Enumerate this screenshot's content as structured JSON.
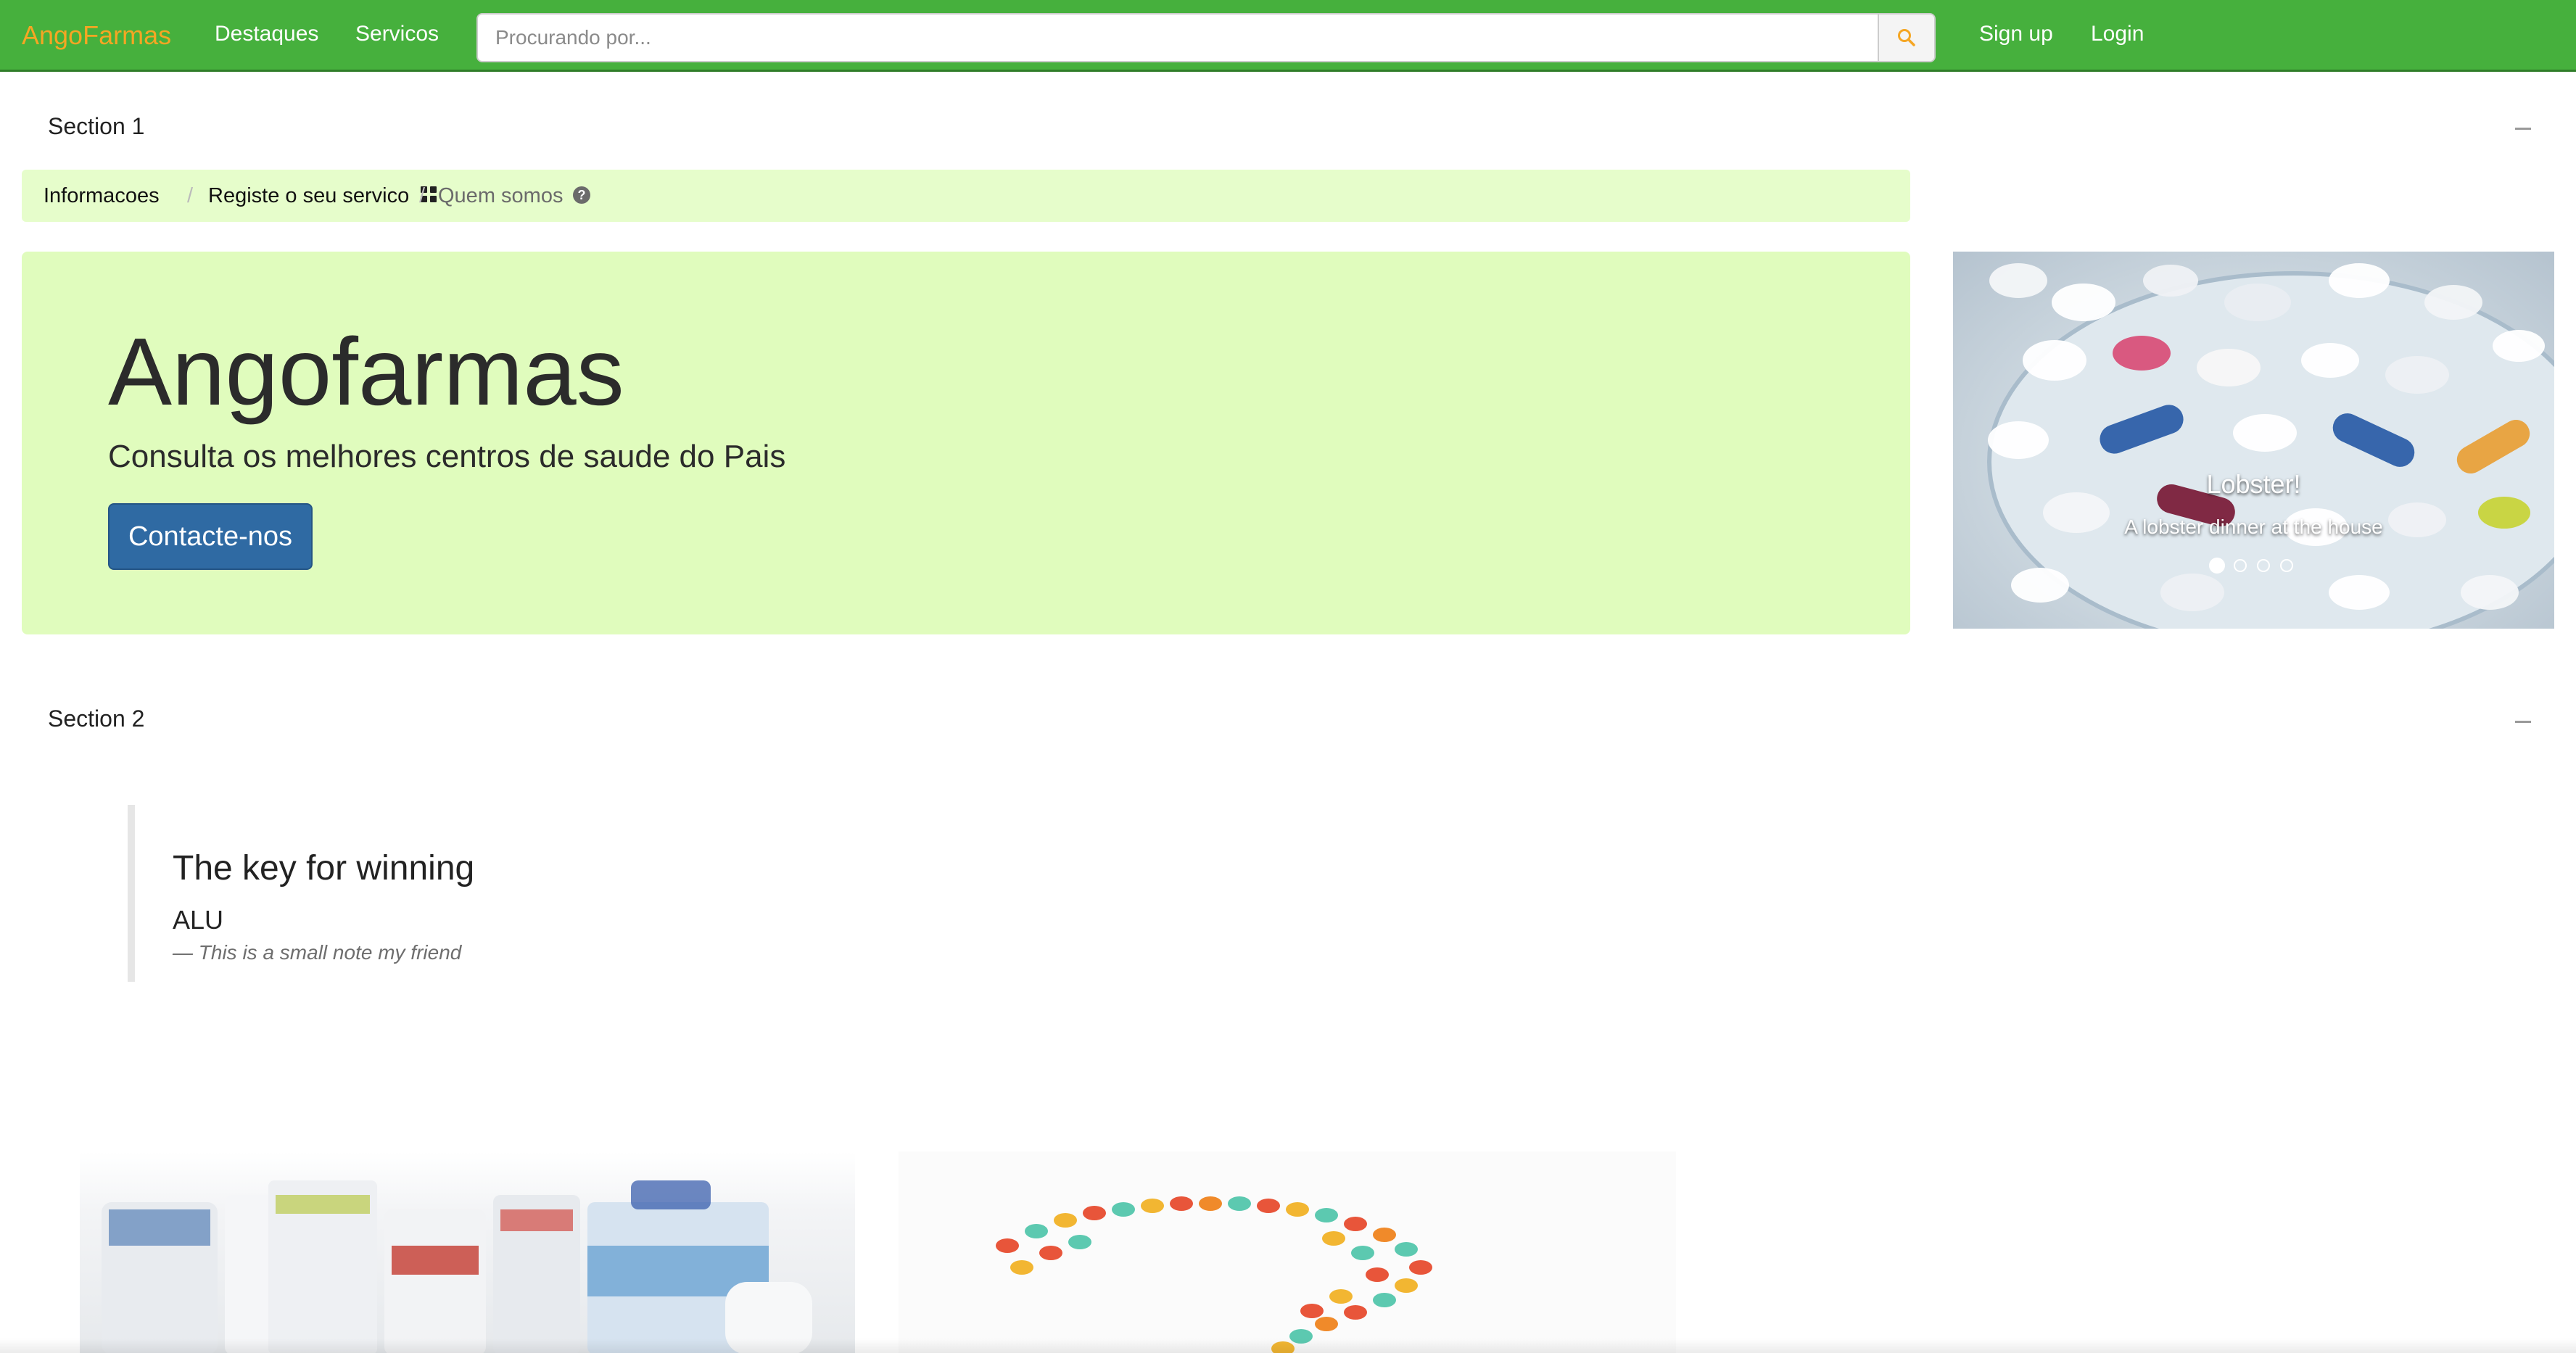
{
  "navbar": {
    "brand": "AngoFarmas",
    "links": [
      "Destaques",
      "Servicos"
    ],
    "search_placeholder": "Procurando por...",
    "auth": {
      "signup": "Sign up",
      "login": "Login"
    }
  },
  "section1": {
    "title": "Section 1",
    "breadcrumb": [
      {
        "label": "Informacoes"
      },
      {
        "label": "Registe o seu servico",
        "icon": "grid-icon"
      },
      {
        "label": "Quem somos",
        "icon": "question-circle-icon"
      }
    ],
    "jumbotron": {
      "title": "Angofarmas",
      "subtitle": "Consulta os melhores centros de saude do Pais",
      "button": "Contacte-nos"
    },
    "carousel": {
      "caption_title": "Lobster!",
      "caption_text": "A lobster dinner at the house",
      "slide_count": 4,
      "active_slide": 1
    }
  },
  "section2": {
    "title": "Section 2",
    "quote": {
      "title": "The key for winning",
      "subtitle": "ALU",
      "footer": "— This is a small note my friend"
    }
  },
  "colors": {
    "navbar": "#46b03d",
    "brand": "#f5a623",
    "jumbotron_bg": "#e0fcbd",
    "breadcrumb_bg": "#e6fdcb",
    "button": "#2f6aa3"
  }
}
